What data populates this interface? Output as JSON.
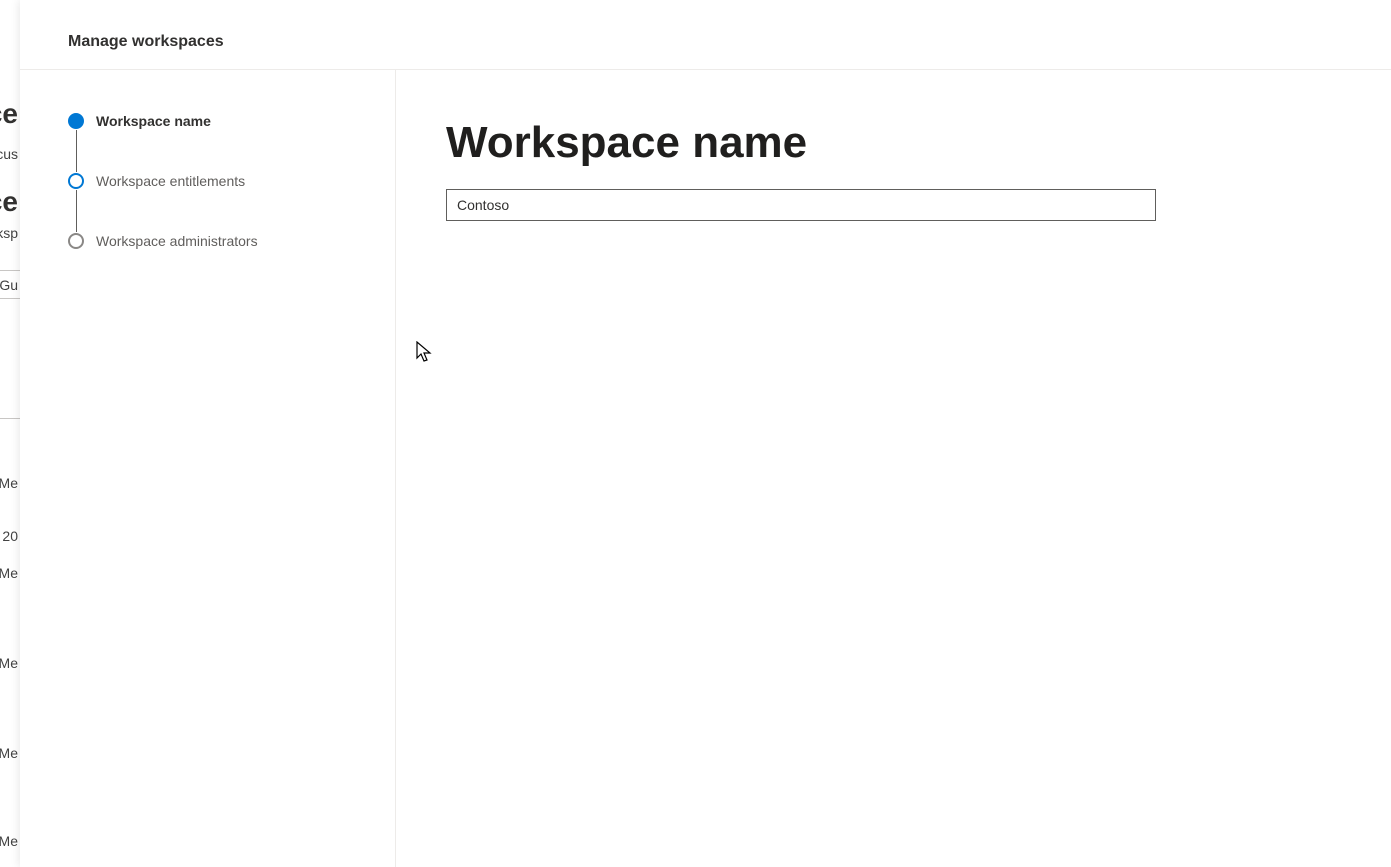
{
  "background": {
    "fragments": {
      "heading1": "ce",
      "text1": "cus",
      "heading2": "ce",
      "text2": "rksp",
      "text3": "l Gu",
      "text4": "Me",
      "text5": "20",
      "text6": "Me",
      "text7": "Me",
      "text8": "Me",
      "text9": "Me"
    }
  },
  "modal": {
    "title": "Manage workspaces"
  },
  "wizard": {
    "steps": [
      {
        "label": "Workspace name",
        "state": "active"
      },
      {
        "label": "Workspace entitlements",
        "state": "next"
      },
      {
        "label": "Workspace administrators",
        "state": "pending"
      }
    ]
  },
  "content": {
    "heading": "Workspace name",
    "workspace_name_value": "Contoso"
  }
}
